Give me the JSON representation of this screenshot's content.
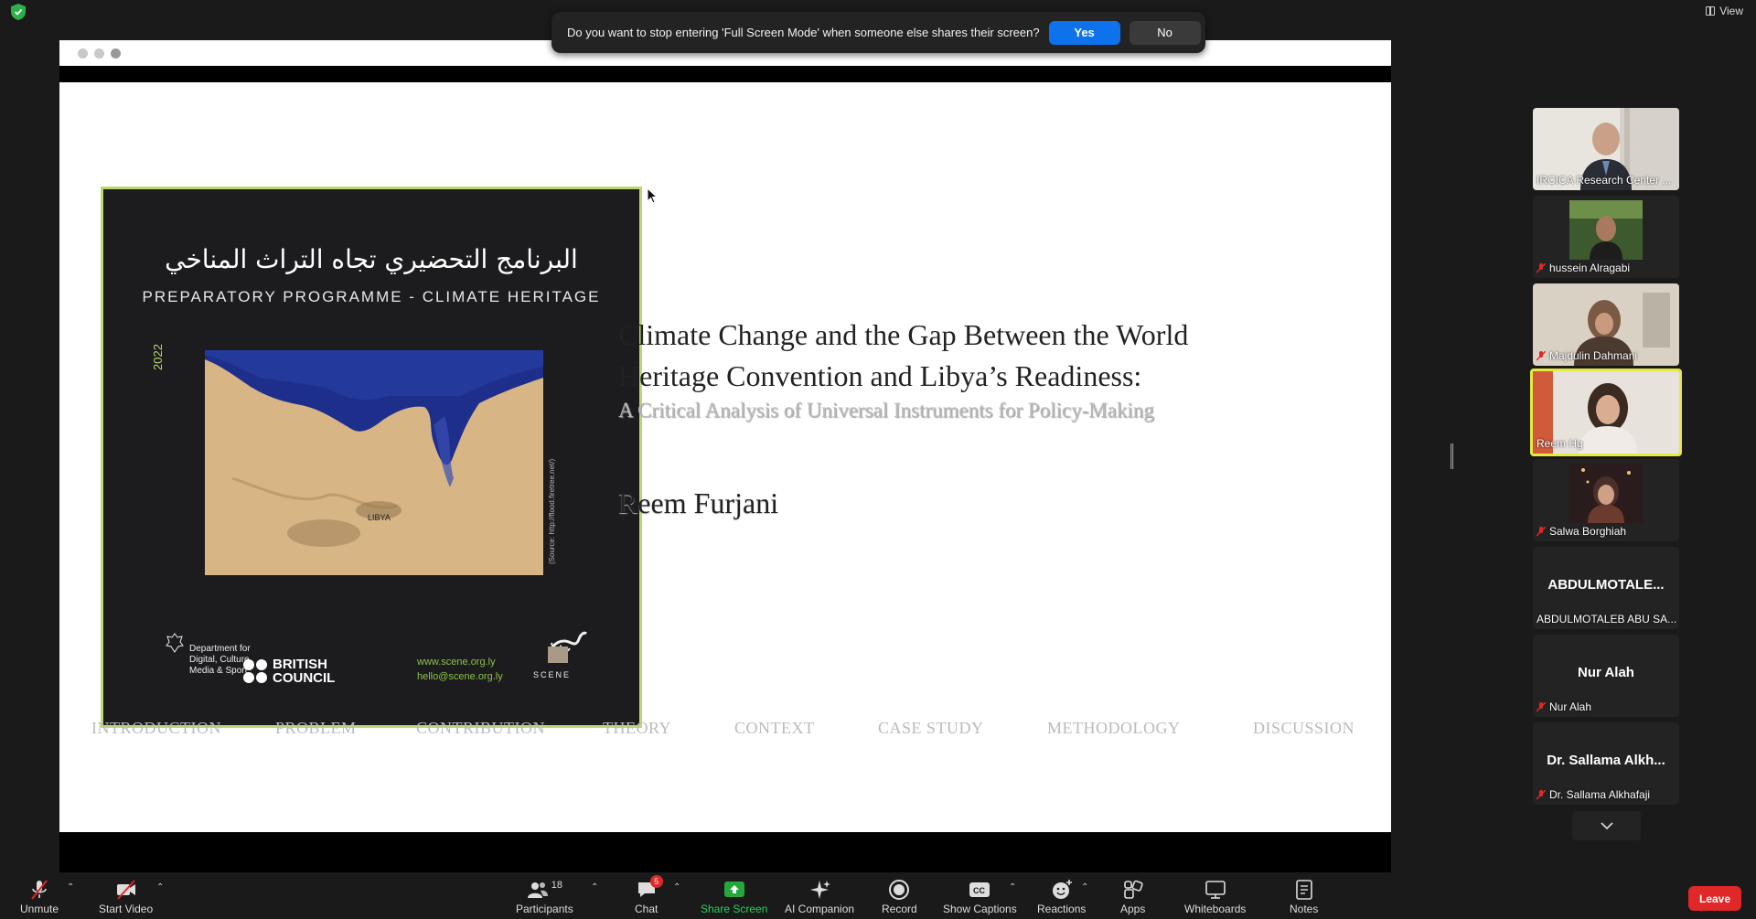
{
  "notification": {
    "message": "Do you want to stop entering 'Full Screen Mode' when someone else shares their screen?",
    "yes_label": "Yes",
    "no_label": "No"
  },
  "view_label": "View",
  "slide": {
    "poster": {
      "arabic_title": "البرنامج التحضيري تجاه التراث المناخي",
      "english_title": "PREPARATORY PROGRAMME - CLIMATE HERITAGE",
      "year": "2022",
      "source_note": "(Source: http://flood.firetree.net/)",
      "map_label": "LIBYA",
      "dcms_text": [
        "Department for",
        "Digital, Culture",
        "Media & Sport"
      ],
      "british_council": [
        "BRITISH",
        "COUNCIL"
      ],
      "website": "www.scene.org.ly",
      "email": "hello@scene.org.ly",
      "scene_logo": "SCENE"
    },
    "title_line1": "Climate Change and the Gap Between the World",
    "title_line2": "Heritage Convention and Libya’s Readiness:",
    "subtitle": "A Critical Analysis of Universal Instruments for Policy-Making",
    "author": "Reem Furjani",
    "nav": [
      "INTRODUCTION",
      "PROBLEM",
      "CONTRIBUTION",
      "THEORY",
      "CONTEXT",
      "CASE STUDY",
      "METHODOLOGY",
      "DISCUSSION"
    ]
  },
  "participants": [
    {
      "name": "IRCICA Research Center ...",
      "muted": false,
      "video": true
    },
    {
      "name": "hussein Alragabi",
      "muted": true,
      "video": true
    },
    {
      "name": "Majdulin Dahmani",
      "muted": true,
      "video": true
    },
    {
      "name": "Reem Hg",
      "muted": false,
      "video": true,
      "active": true
    },
    {
      "name": "Salwa Borghiah",
      "muted": true,
      "video": true
    },
    {
      "name": "ABDULMOTALEB ABU SA...",
      "display": "ABDULMOTALE...",
      "muted": false,
      "video": false
    },
    {
      "name": "Nur Alah",
      "display": "Nur Alah",
      "muted": true,
      "video": false
    },
    {
      "name": "Dr. Sallama Alkhafaji",
      "display": "Dr. Sallama Alkh...",
      "muted": true,
      "video": false
    }
  ],
  "toolbar": {
    "unmute": "Unmute",
    "start_video": "Start Video",
    "participants": "Participants",
    "participants_count": "18",
    "chat": "Chat",
    "chat_badge": "5",
    "share_screen": "Share Screen",
    "ai_companion": "AI Companion",
    "record": "Record",
    "show_captions": "Show Captions",
    "reactions": "Reactions",
    "apps": "Apps",
    "whiteboards": "Whiteboards",
    "notes": "Notes",
    "leave": "Leave"
  },
  "colors": {
    "accent_blue": "#0e72ed",
    "leave_red": "#e02828",
    "active_speaker": "#e5ea43",
    "share_green": "#23a839"
  }
}
